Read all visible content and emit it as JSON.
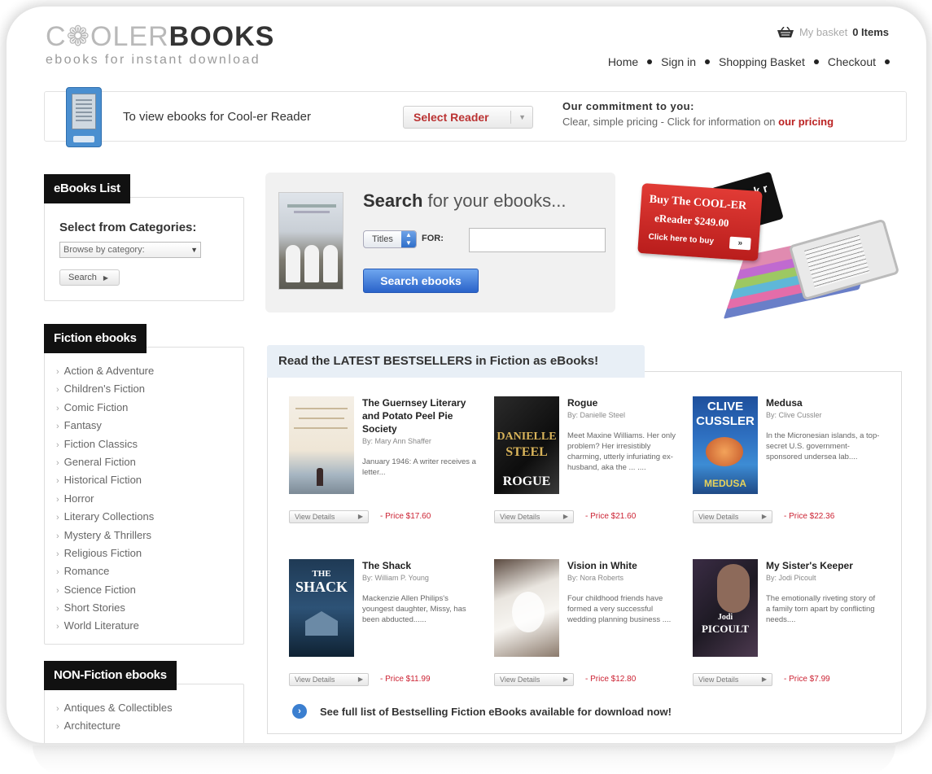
{
  "header": {
    "logo_light": "C❁OLER",
    "logo_dark": "BOOKS",
    "tagline": "ebooks for instant download",
    "basket_label": "My basket",
    "basket_count": "0 Items",
    "nav": [
      "Home",
      "Sign in",
      "Shopping Basket",
      "Checkout"
    ]
  },
  "reader_bar": {
    "text": "To view ebooks for Cool-er Reader",
    "select_label": "Select Reader",
    "commit_title": "Our commitment to you:",
    "commit_text": "Clear, simple pricing - Click for information on",
    "commit_link": "our pricing"
  },
  "sidebar": {
    "ebooks_list_tab": "eBooks List",
    "categories_title": "Select from Categories:",
    "browse_placeholder": "Browse by category:",
    "search_button": "Search",
    "fiction_tab": "Fiction ebooks",
    "fiction_items": [
      "Action & Adventure",
      "Children's Fiction",
      "Comic Fiction",
      "Fantasy",
      "Fiction Classics",
      "General Fiction",
      "Historical Fiction",
      "Horror",
      "Literary Collections",
      "Mystery & Thrillers",
      "Religious Fiction",
      "Romance",
      "Science Fiction",
      "Short Stories",
      "World Literature"
    ],
    "nonfiction_tab": "NON-Fiction ebooks",
    "nonfiction_items": [
      "Antiques & Collectibles",
      "Architecture"
    ]
  },
  "search": {
    "heading_bold": "Search",
    "heading_rest": "for your ebooks...",
    "type_value": "Titles",
    "for_label": "FOR:",
    "input_value": "",
    "button_label": "Search ebooks"
  },
  "promo": {
    "line1": "Buy The COOL-ER",
    "line2": "eReader $249.00",
    "line3": "Click here to buy",
    "arrow": "»",
    "black_text": "k r"
  },
  "bestsellers": {
    "heading": "Read the LATEST BESTSELLERS in Fiction as eBooks!",
    "view_label": "View Details",
    "books": [
      {
        "title": "The Guernsey Literary and Potato Peel Pie Society",
        "author": "By: Mary Ann Shaffer",
        "desc": "January 1946: A writer receives a letter...",
        "price": "- Price $17.60"
      },
      {
        "title": "Rogue",
        "author": "By: Danielle Steel",
        "desc": "Meet Maxine Williams. Her only problem? Her irresistibly charming, utterly infuriating ex-husband, aka the ... ....",
        "price": "- Price $21.60"
      },
      {
        "title": "Medusa",
        "author": "By: Clive Cussler",
        "desc": "In the Micronesian islands, a top-secret U.S. government-sponsored undersea lab....",
        "price": "- Price $22.36"
      },
      {
        "title": "The Shack",
        "author": "By: William P. Young",
        "desc": "Mackenzie Allen Philips's youngest daughter, Missy, has been abducted......",
        "price": "- Price $11.99"
      },
      {
        "title": "Vision in White",
        "author": "By: Nora Roberts",
        "desc": "Four childhood friends have formed a very successful wedding planning business ....",
        "price": "- Price $12.80"
      },
      {
        "title": "My Sister's Keeper",
        "author": "By: Jodi Picoult",
        "desc": "The emotionally riveting story of a family torn apart by conflicting needs....",
        "price": "- Price $7.99"
      }
    ],
    "cover_texts": {
      "rogue_1": "DANIELLE",
      "rogue_2": "STEEL",
      "rogue_3": "ROGUE",
      "medusa_1": "CLIVE",
      "medusa_2": "CUSSLER",
      "medusa_3": "MEDUSA",
      "shack_1": "THE",
      "shack_2": "SHACK",
      "keeper_1": "Jodi",
      "keeper_2": "PICOULT"
    },
    "see_full": "See full list of Bestselling Fiction eBooks available for download now!"
  },
  "colors": {
    "accent_red": "#b22222",
    "button_blue": "#2a63c9",
    "tab_black": "#111111"
  }
}
